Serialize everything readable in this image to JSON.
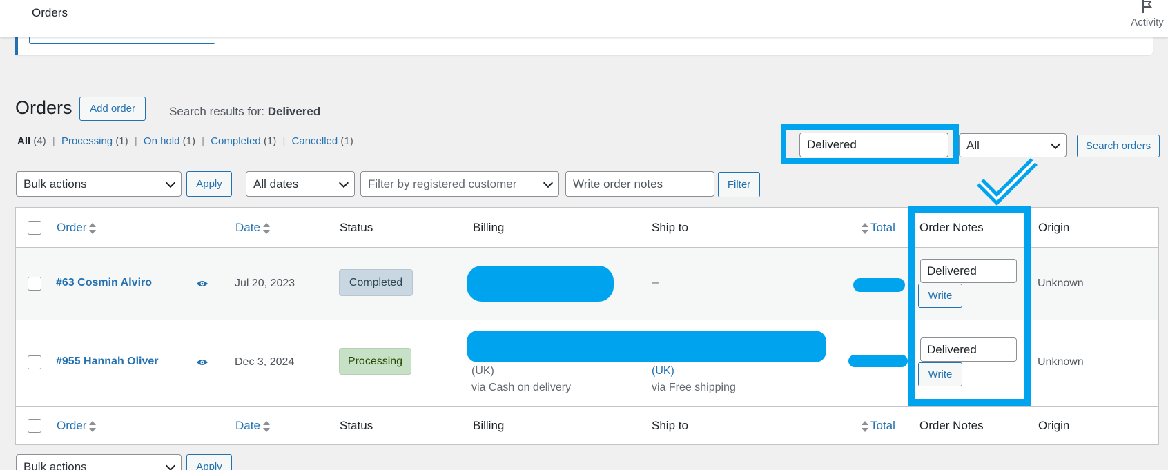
{
  "topbar": {
    "title": "Orders",
    "activity_label": "Activity"
  },
  "page": {
    "title": "Orders",
    "add_order_label": "Add order",
    "search_results_prefix": "Search results for:",
    "search_term": "Delivered"
  },
  "subsubsub": [
    {
      "label": "All",
      "count": "(4)",
      "current": true
    },
    {
      "label": "Processing",
      "count": "(1)"
    },
    {
      "label": "On hold",
      "count": "(1)"
    },
    {
      "label": "Completed",
      "count": "(1)"
    },
    {
      "label": "Cancelled",
      "count": "(1)"
    }
  ],
  "search": {
    "value": "Delivered",
    "type_selected": "All",
    "button_label": "Search orders"
  },
  "filters": {
    "bulk_actions": "Bulk actions",
    "apply_label": "Apply",
    "dates_selected": "All dates",
    "customer_placeholder": "Filter by registered customer",
    "order_notes_placeholder": "Write order notes",
    "filter_label": "Filter"
  },
  "table": {
    "columns": {
      "order": "Order",
      "date": "Date",
      "status": "Status",
      "billing": "Billing",
      "ship_to": "Ship to",
      "total": "Total",
      "order_notes": "Order Notes",
      "origin": "Origin"
    },
    "rows": [
      {
        "order": "#63 Cosmin Alviro",
        "date": "Jul 20, 2023",
        "status": "Completed",
        "ship_to": "–",
        "note_value": "Delivered",
        "write_label": "Write",
        "origin": "Unknown"
      },
      {
        "order": "#955 Hannah Oliver",
        "date": "Dec 3, 2024",
        "status": "Processing",
        "billing_country": "(UK)",
        "billing_method": "via Cash on delivery",
        "ship_country": "(UK)",
        "ship_method": "via Free shipping",
        "note_value": "Delivered",
        "write_label": "Write",
        "origin": "Unknown"
      }
    ]
  },
  "colors": {
    "accent": "#2271b1",
    "highlight": "#00a3ee",
    "completed_badge": "#c8d7e1",
    "processing_badge": "#c6e1c6"
  }
}
